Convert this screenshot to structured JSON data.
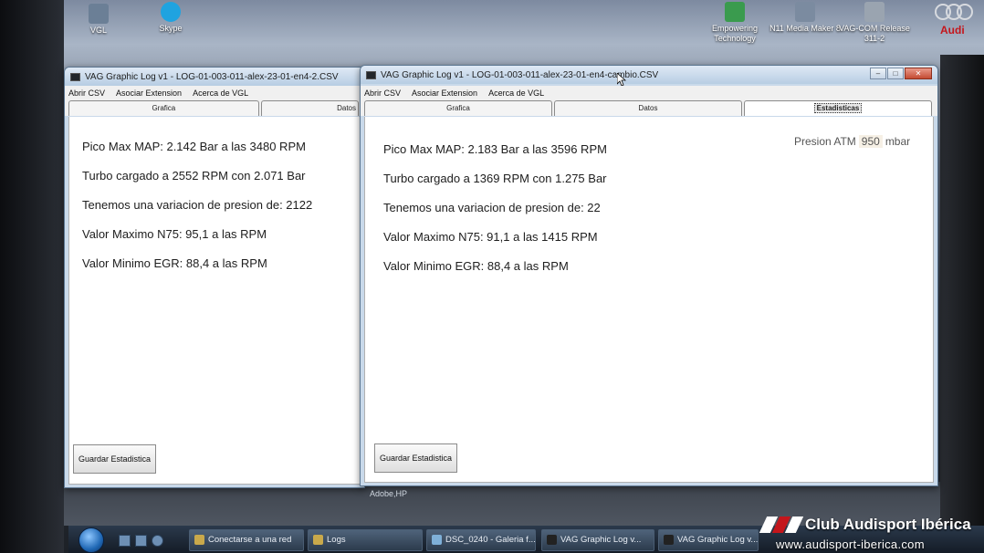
{
  "desktop": {
    "icons": [
      {
        "label": "VGL",
        "color": "#6b7f96"
      },
      {
        "label": "Skype",
        "color": "#1fa3e0"
      },
      {
        "label": "Empowering Technology",
        "color": "#3a9b4e"
      },
      {
        "label": "N11 Media Maker 8",
        "color": "#7b8ba0"
      },
      {
        "label": "VAG-COM Release 311-2",
        "color": "#9aa4b0"
      }
    ],
    "brand": "Audi"
  },
  "window_back": {
    "title": "VAG Graphic Log  v1 -  LOG-01-003-011-alex-23-01-en4-2.CSV",
    "menu": [
      "Abrir CSV",
      "Asociar Extension",
      "Acerca de VGL"
    ],
    "tabs": [
      "Grafica",
      "Datos"
    ],
    "stats": [
      "Pico Max MAP: 2.142 Bar a las 3480 RPM",
      "Turbo cargado a 2552 RPM con 2.071 Bar",
      "Tenemos una variacion de presion de: 2122",
      "Valor Maximo N75: 95,1 a las  RPM",
      "Valor Minimo EGR: 88,4 a las  RPM"
    ],
    "save_button": "Guardar  Estadistica"
  },
  "window_front": {
    "title": "VAG Graphic Log  v1 -  LOG-01-003-011-alex-23-01-en4-cambio.CSV",
    "menu": [
      "Abrir CSV",
      "Asociar Extension",
      "Acerca de VGL"
    ],
    "tabs": [
      "Grafica",
      "Datos",
      "Estadisticas"
    ],
    "active_tab": "Estadisticas",
    "stats": [
      "Pico Max MAP: 2.183 Bar a las 3596 RPM",
      "Turbo cargado a 1369 RPM con 1.275 Bar",
      "Tenemos una variacion de presion de: 22",
      "Valor Maximo N75: 91,1 a las 1415 RPM",
      "Valor Minimo EGR: 88,4 a las  RPM"
    ],
    "atm_label": "Presion ATM",
    "atm_value": "950",
    "atm_unit": "mbar",
    "save_button": "Guardar  Estadistica"
  },
  "taskbar": {
    "items": [
      "Conectarse a una red",
      "Logs",
      "DSC_0240 - Galeria f...",
      "VAG Graphic Log  v...",
      "VAG Graphic Log  v..."
    ]
  },
  "watermark": {
    "title": "Club Audisport Ibérica",
    "url": "www.audisport-iberica.com"
  },
  "misc": {
    "adobe_text": "Adobe,HP"
  }
}
